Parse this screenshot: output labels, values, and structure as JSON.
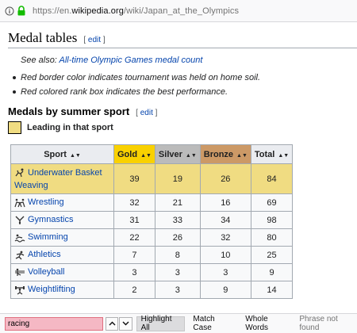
{
  "browser": {
    "url_prefix": "https://en.",
    "url_domain": "wikipedia.org",
    "url_path": "/wiki/Japan_at_the_Olympics",
    "info_icon": "info-icon",
    "lock_icon": "lock-icon",
    "lock_color": "#12bc00"
  },
  "section": {
    "title": "Medal tables",
    "edit_open": "[",
    "edit_label": "edit",
    "edit_close": "]"
  },
  "hatnote": {
    "prefix": "See also: ",
    "link": "All-time Olympic Games medal count"
  },
  "notes": [
    "Red border color indicates tournament was held on home soil.",
    "Red colored rank box indicates the best performance."
  ],
  "subsection": {
    "title": "Medals by summer sport",
    "edit_open": "[",
    "edit_label": "edit",
    "edit_close": "]"
  },
  "legend": {
    "label": "Leading in that sport",
    "color": "#f0dc82"
  },
  "table": {
    "headers": {
      "sport": "Sport",
      "gold": "Gold",
      "silver": "Silver",
      "bronze": "Bronze",
      "total": "Total"
    },
    "sort_icon": "sort-icon",
    "colors": {
      "gold": "#f9d100",
      "silver": "#bbbbbb",
      "bronze": "#cc9966",
      "leading": "#f0dc82"
    },
    "rows": [
      {
        "sport": "Underwater Basket Weaving",
        "icon": "underwater-basket-weaving-icon",
        "gold": "39",
        "silver": "19",
        "bronze": "26",
        "total": "84",
        "leading": true
      },
      {
        "sport": "Wrestling",
        "icon": "wrestling-icon",
        "gold": "32",
        "silver": "21",
        "bronze": "16",
        "total": "69",
        "leading": false
      },
      {
        "sport": "Gymnastics",
        "icon": "gymnastics-icon",
        "gold": "31",
        "silver": "33",
        "bronze": "34",
        "total": "98",
        "leading": false
      },
      {
        "sport": "Swimming",
        "icon": "swimming-icon",
        "gold": "22",
        "silver": "26",
        "bronze": "32",
        "total": "80",
        "leading": false
      },
      {
        "sport": "Athletics",
        "icon": "athletics-icon",
        "gold": "7",
        "silver": "8",
        "bronze": "10",
        "total": "25",
        "leading": false
      },
      {
        "sport": "Volleyball",
        "icon": "volleyball-icon",
        "gold": "3",
        "silver": "3",
        "bronze": "3",
        "total": "9",
        "leading": false
      },
      {
        "sport": "Weightlifting",
        "icon": "weightlifting-icon",
        "gold": "2",
        "silver": "3",
        "bronze": "9",
        "total": "14",
        "leading": false
      }
    ]
  },
  "findbar": {
    "query": "racing",
    "prev_icon": "chevron-up-icon",
    "next_icon": "chevron-down-icon",
    "highlight_all": "Highlight All",
    "match_case": "Match Case",
    "whole_words": "Whole Words",
    "status": "Phrase not found",
    "highlight_all_on": true
  }
}
